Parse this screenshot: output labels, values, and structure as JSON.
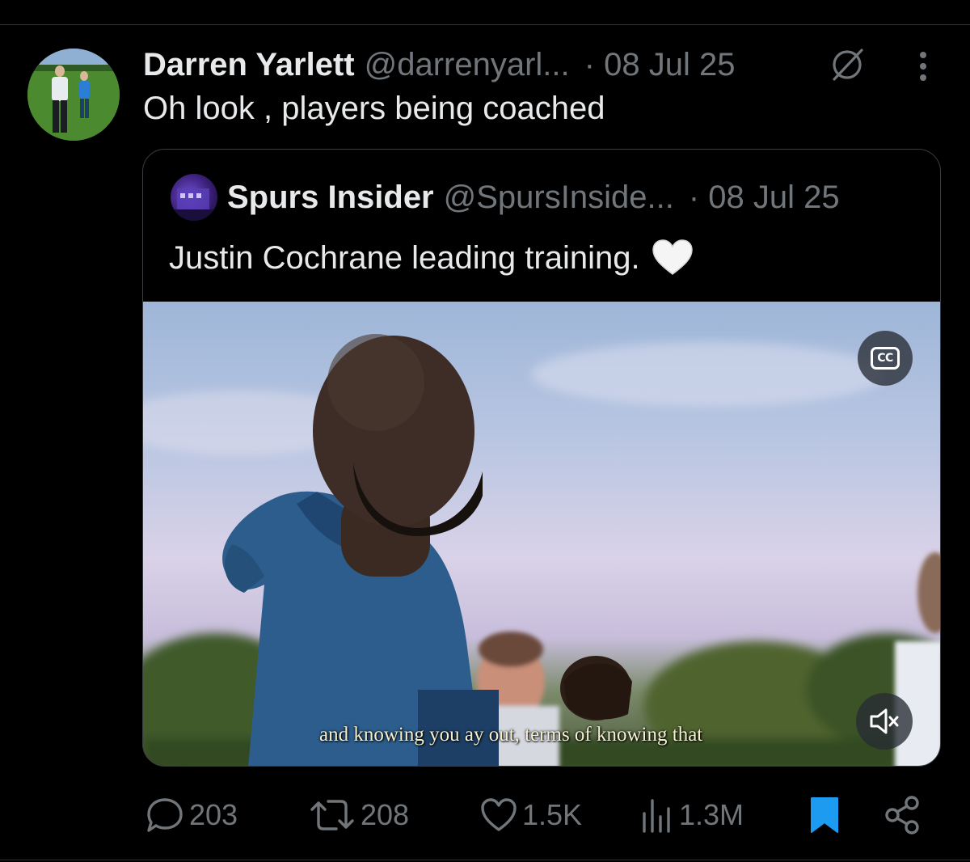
{
  "tweet": {
    "display_name": "Darren Yarlett",
    "handle": "@darrenyarl...",
    "date": "· 08 Jul 25",
    "text": "Oh look , players being coached"
  },
  "quote": {
    "display_name": "Spurs Insider",
    "handle": "@SpursInside...",
    "date": "· 08 Jul 25",
    "text": "Justin Cochrane leading training.",
    "emoji": "white-heart",
    "video": {
      "cc_label": "CC",
      "subtitle": "and knowing you      ay out,    terms of knowing that"
    }
  },
  "actions": {
    "replies": "203",
    "reposts": "208",
    "likes": "1.5K",
    "views": "1.3M",
    "bookmarked": true
  },
  "colors": {
    "background": "#000000",
    "text_primary": "#e7e9ea",
    "text_secondary": "#71767b",
    "bookmark_active": "#1d9bf0",
    "border": "#2f3336"
  },
  "icons": [
    "comment-icon",
    "repost-icon",
    "heart-icon",
    "views-icon",
    "bookmark-icon",
    "share-icon",
    "more-icon",
    "edited-icon",
    "cc-icon",
    "muted-speaker-icon"
  ]
}
